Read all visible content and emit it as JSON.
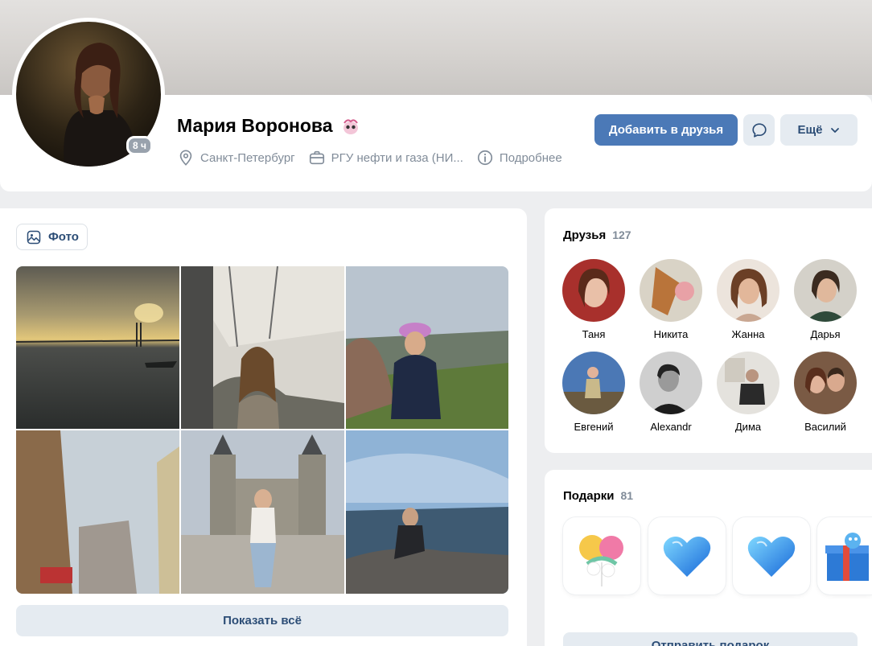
{
  "profile": {
    "name": "Мария Воронова",
    "online_badge": "8 ч",
    "city": "Санкт-Петербург",
    "university": "РГУ нефти и газа (НИ...",
    "details_label": "Подробнее",
    "add_friend_label": "Добавить в друзья",
    "more_label": "Ещё",
    "icons": [
      "location-pin-icon",
      "briefcase-icon",
      "info-icon",
      "message-icon",
      "chevron-down-icon",
      "emoji-badge-icon"
    ]
  },
  "photos": {
    "tab_label": "Фото",
    "show_all_label": "Показать всё",
    "items": [
      "sunset-bridge",
      "cafe-terrace",
      "woman-pink-hat",
      "street-buildings",
      "castle-gate",
      "woman-on-rocks"
    ]
  },
  "friends": {
    "title": "Друзья",
    "count": "127",
    "items": [
      {
        "name": "Таня"
      },
      {
        "name": "Никита"
      },
      {
        "name": "Жанна"
      },
      {
        "name": "Дарья"
      },
      {
        "name": "Евгений"
      },
      {
        "name": "Alexandr"
      },
      {
        "name": "Дима"
      },
      {
        "name": "Василий"
      }
    ]
  },
  "gifts": {
    "title": "Подарки",
    "count": "81",
    "send_label": "Отправить подарок",
    "items": [
      "balloons-gift",
      "blue-heart-gift",
      "blue-heart-gift",
      "present-box-gift"
    ]
  },
  "colors": {
    "accent": "#4b79b7",
    "secondary_button": "#e5ebf1",
    "link_text": "#2c4d76",
    "muted_text": "#818c99",
    "page_bg": "#edeef0"
  }
}
